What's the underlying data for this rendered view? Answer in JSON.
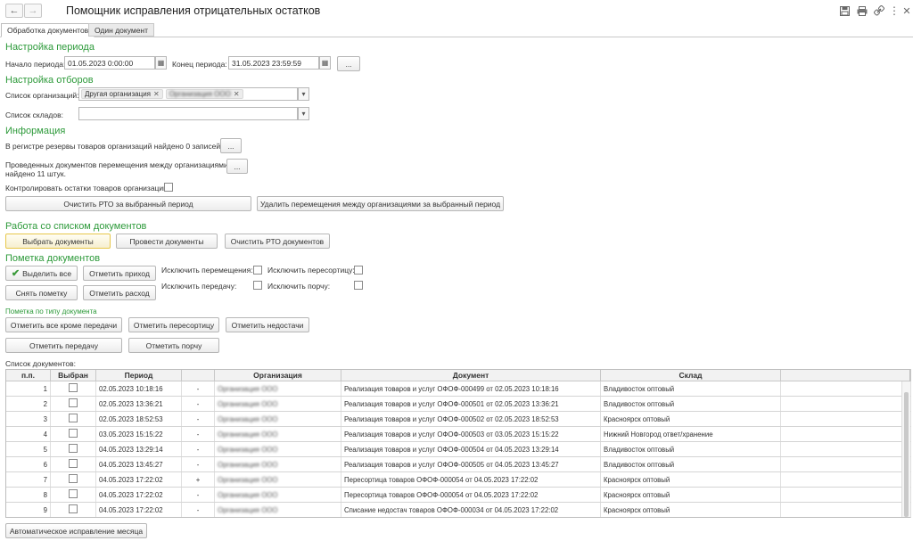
{
  "window": {
    "title": "Помощник исправления отрицательных остатков",
    "back_icon": "arrow-left-icon",
    "forward_icon": "arrow-right-icon"
  },
  "top_icons": [
    "save-icon",
    "print-icon",
    "link-icon",
    "more-icon",
    "close-icon"
  ],
  "tabs": [
    {
      "label": "Обработка документов",
      "active": true
    },
    {
      "label": "Один документ",
      "active": false
    }
  ],
  "period": {
    "section_title": "Настройка периода",
    "start_label": "Начало периода:",
    "start_value": "01.05.2023  0:00:00",
    "end_label": "Конец периода:",
    "end_value": "31.05.2023 23:59:59",
    "more_label": "..."
  },
  "filters": {
    "section_title": "Настройка отборов",
    "orgs_label": "Список организаций:",
    "orgs_tags": [
      "Другая организация",
      "Организация ООО"
    ],
    "warehouses_label": "Список складов:",
    "warehouses_value": ""
  },
  "info": {
    "section_title": "Информация",
    "register_text": "В регистре  резервы товаров организаций найдено 0 записей.",
    "register_btn": "...",
    "moves_text_1": "Проведенных документов перемещения между организациями",
    "moves_text_2": "найдено 11 штук.",
    "moves_btn": "...",
    "control_label": "Контролировать остатки товаров организаций:",
    "clear_rto_btn": "Очистить РТО за выбранный период",
    "delete_moves_btn": "Удалить перемещения между организациями за выбранный период"
  },
  "doc_list_work": {
    "section_title": "Работа со списком документов",
    "select_btn": "Выбрать документы",
    "post_btn": "Провести документы",
    "clear_btn": "Очистить РТО документов"
  },
  "marking": {
    "section_title": "Пометка документов",
    "select_all_btn": "Выделить все",
    "mark_income_btn": "Отметить приход",
    "unmark_btn": "Снять пометку",
    "mark_expense_btn": "Отметить расход",
    "excl_moves_label": "Исключить перемещения:",
    "excl_regrade_label": "Исключить пересортицу:",
    "excl_transfer_label": "Исключить передачу:",
    "excl_damage_label": "Исключить порчу:",
    "by_type_title": "Пометка по типу документа",
    "mark_except_transfer_btn": "Отметить все кроме передачи",
    "mark_regrade_btn": "Отметить пересортицу",
    "mark_shortage_btn": "Отметить недостачи",
    "mark_transfer_btn": "Отметить передачу",
    "mark_damage_btn": "Отметить порчу"
  },
  "table": {
    "caption": "Список документов:",
    "columns": [
      "п.п.",
      "Выбран",
      "Период",
      "",
      "Организация",
      "Документ",
      "Склад"
    ],
    "rows": [
      {
        "n": "1",
        "period": "02.05.2023 10:18:16",
        "mark": "-",
        "org": "Организация ООО",
        "doc": "Реализация товаров и услуг ОФОФ-000499 от 02.05.2023 10:18:16",
        "warehouse": "Владивосток оптовый"
      },
      {
        "n": "2",
        "period": "02.05.2023 13:36:21",
        "mark": "-",
        "org": "Организация ООО",
        "doc": "Реализация товаров и услуг ОФОФ-000501 от 02.05.2023 13:36:21",
        "warehouse": "Владивосток оптовый"
      },
      {
        "n": "3",
        "period": "02.05.2023 18:52:53",
        "mark": "-",
        "org": "Организация ООО",
        "doc": "Реализация товаров и услуг ОФОФ-000502 от 02.05.2023 18:52:53",
        "warehouse": "Красноярск оптовый"
      },
      {
        "n": "4",
        "period": "03.05.2023 15:15:22",
        "mark": "-",
        "org": "Организация ООО",
        "doc": "Реализация товаров и услуг ОФОФ-000503 от 03.05.2023 15:15:22",
        "warehouse": "Нижний Новгород ответ/хранение"
      },
      {
        "n": "5",
        "period": "04.05.2023 13:29:14",
        "mark": "-",
        "org": "Организация ООО",
        "doc": "Реализация товаров и услуг ОФОФ-000504 от 04.05.2023 13:29:14",
        "warehouse": "Владивосток оптовый"
      },
      {
        "n": "6",
        "period": "04.05.2023 13:45:27",
        "mark": "-",
        "org": "Организация ООО",
        "doc": "Реализация товаров и услуг ОФОФ-000505 от 04.05.2023 13:45:27",
        "warehouse": "Владивосток оптовый"
      },
      {
        "n": "7",
        "period": "04.05.2023 17:22:02",
        "mark": "+",
        "org": "Организация ООО",
        "doc": "Пересортица товаров ОФОФ-000054 от 04.05.2023 17:22:02",
        "warehouse": "Красноярск оптовый"
      },
      {
        "n": "8",
        "period": "04.05.2023 17:22:02",
        "mark": "-",
        "org": "Организация ООО",
        "doc": "Пересортица товаров ОФОФ-000054 от 04.05.2023 17:22:02",
        "warehouse": "Красноярск оптовый"
      },
      {
        "n": "9",
        "period": "04.05.2023 17:22:02",
        "mark": "-",
        "org": "Организация ООО",
        "doc": "Списание недостач товаров ОФОФ-000034 от 04.05.2023 17:22:02",
        "warehouse": "Красноярск оптовый"
      }
    ]
  },
  "footer": {
    "auto_fix_btn": "Автоматическое исправление месяца"
  }
}
